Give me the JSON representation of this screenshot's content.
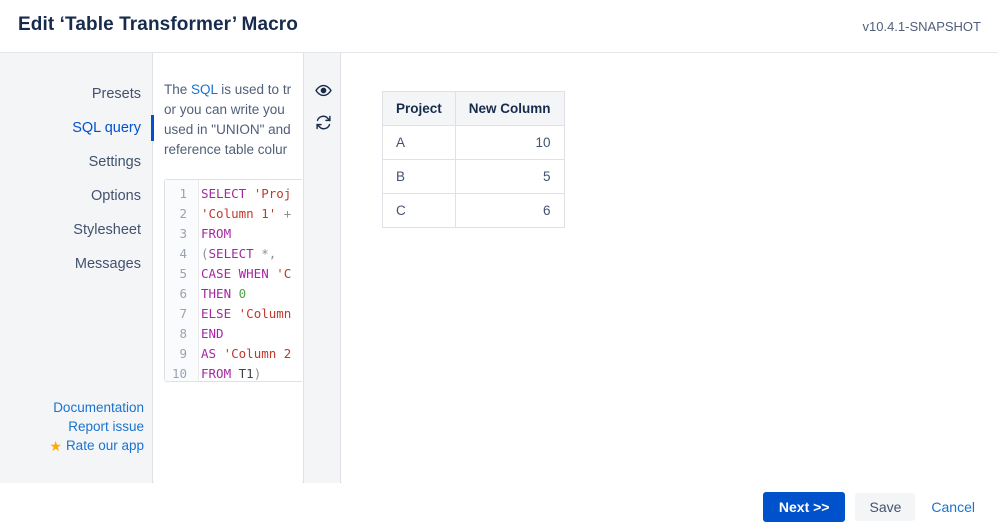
{
  "header": {
    "title": "Edit ‘Table Transformer’ Macro",
    "version": "v10.4.1-SNAPSHOT"
  },
  "sidebar": {
    "items": [
      {
        "label": "Presets",
        "active": false
      },
      {
        "label": "SQL query",
        "active": true
      },
      {
        "label": "Settings",
        "active": false
      },
      {
        "label": "Options",
        "active": false
      },
      {
        "label": "Stylesheet",
        "active": false
      },
      {
        "label": "Messages",
        "active": false
      }
    ],
    "links": [
      {
        "label": "Documentation",
        "icon": null
      },
      {
        "label": "Report issue",
        "icon": null
      },
      {
        "label": "Rate our app",
        "icon": "star-icon"
      }
    ]
  },
  "description": {
    "line1_prefix": "The ",
    "link_text": "SQL",
    "line1_suffix": " is used to tr",
    "line2": "or you can write you",
    "line3": "used in \"UNION\" and",
    "line4": "reference table colur"
  },
  "rail": {
    "preview_icon": "eye-icon",
    "refresh_icon": "refresh-icon"
  },
  "code": {
    "lines": [
      {
        "n": "1",
        "tokens": [
          {
            "t": "kw",
            "v": "SELECT"
          },
          {
            "t": "idn",
            "v": " "
          },
          {
            "t": "str",
            "v": "'Proj"
          }
        ]
      },
      {
        "n": "2",
        "tokens": [
          {
            "t": "str",
            "v": "'Column 1'"
          },
          {
            "t": "pun",
            "v": " +"
          }
        ]
      },
      {
        "n": "3",
        "tokens": [
          {
            "t": "kw",
            "v": "FROM"
          }
        ]
      },
      {
        "n": "4",
        "tokens": [
          {
            "t": "pun",
            "v": "("
          },
          {
            "t": "kw",
            "v": "SELECT"
          },
          {
            "t": "pun",
            "v": " *,"
          }
        ]
      },
      {
        "n": "5",
        "tokens": [
          {
            "t": "kw",
            "v": "CASE WHEN"
          },
          {
            "t": "idn",
            "v": " "
          },
          {
            "t": "str",
            "v": "'C"
          }
        ]
      },
      {
        "n": "6",
        "tokens": [
          {
            "t": "kw",
            "v": "THEN"
          },
          {
            "t": "idn",
            "v": " "
          },
          {
            "t": "num",
            "v": "0"
          }
        ]
      },
      {
        "n": "7",
        "tokens": [
          {
            "t": "kw",
            "v": "ELSE"
          },
          {
            "t": "idn",
            "v": " "
          },
          {
            "t": "str",
            "v": "'Column"
          }
        ]
      },
      {
        "n": "8",
        "tokens": [
          {
            "t": "kw",
            "v": "END"
          }
        ]
      },
      {
        "n": "9",
        "tokens": [
          {
            "t": "kw",
            "v": "AS"
          },
          {
            "t": "idn",
            "v": " "
          },
          {
            "t": "str",
            "v": "'Column 2"
          }
        ]
      },
      {
        "n": "10",
        "tokens": [
          {
            "t": "kw",
            "v": "FROM"
          },
          {
            "t": "idn",
            "v": " T1"
          },
          {
            "t": "pun",
            "v": ")"
          }
        ]
      }
    ]
  },
  "result_table": {
    "headers": [
      "Project",
      "New Column"
    ],
    "rows": [
      [
        "A",
        "10"
      ],
      [
        "B",
        "5"
      ],
      [
        "C",
        "6"
      ]
    ]
  },
  "footer": {
    "next_label": "Next >>",
    "save_label": "Save",
    "cancel_label": "Cancel"
  },
  "colors": {
    "accent": "#0052cc",
    "link": "#1a73cf",
    "text_dark": "#172b4d",
    "text_muted": "#42526e",
    "panel_bg": "#f4f5f7",
    "border": "#dfe1e6",
    "star": "#ffab00"
  }
}
